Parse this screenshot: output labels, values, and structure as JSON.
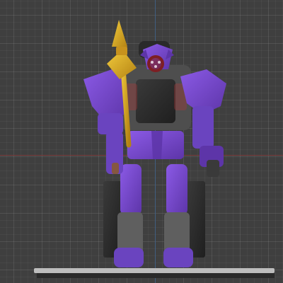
{
  "viewport": {
    "background_color": "#3f3f3f",
    "grid_color": "#4a4a4a",
    "x_axis_color": "#8a3b3b",
    "z_axis_color": "#3f5f86"
  },
  "model": {
    "primary_color": "#7a4ad1",
    "dark_color": "#2b2b2b",
    "accent_gold": "#d6a21a",
    "eye_color": "#c01e2a"
  }
}
